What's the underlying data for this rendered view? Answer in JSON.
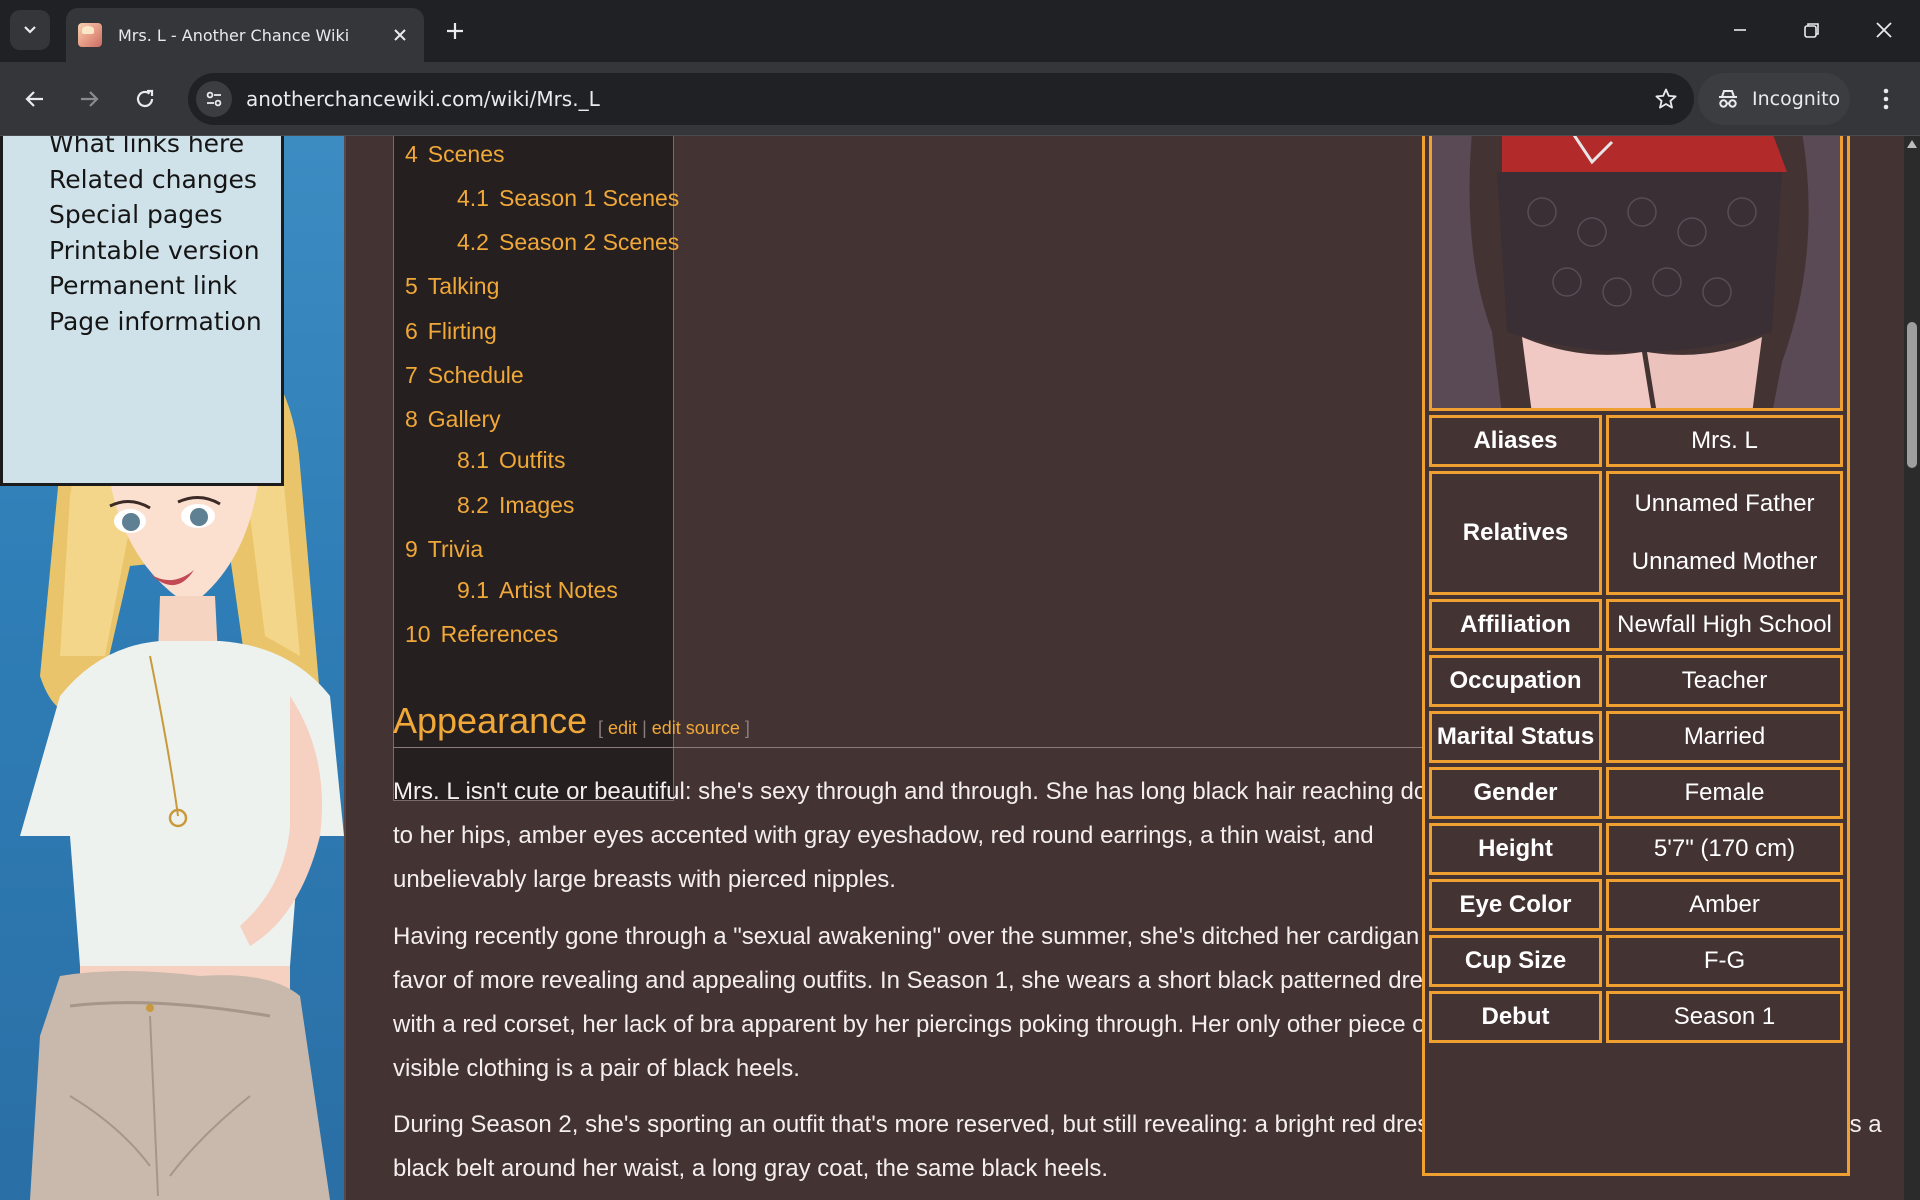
{
  "browser": {
    "tab_title": "Mrs. L - Another Chance Wiki",
    "url": "anotherchancewiki.com/wiki/Mrs._L",
    "profile_label": "Incognito"
  },
  "sidebar_tools": [
    "What links here",
    "Related changes",
    "Special pages",
    "Printable version",
    "Permanent link",
    "Page information"
  ],
  "toc": [
    {
      "num": "4",
      "label": "Scenes"
    },
    {
      "num": "4.1",
      "label": "Season 1 Scenes"
    },
    {
      "num": "4.2",
      "label": "Season 2 Scenes"
    },
    {
      "num": "5",
      "label": "Talking"
    },
    {
      "num": "6",
      "label": "Flirting"
    },
    {
      "num": "7",
      "label": "Schedule"
    },
    {
      "num": "8",
      "label": "Gallery"
    },
    {
      "num": "8.1",
      "label": "Outfits"
    },
    {
      "num": "8.2",
      "label": "Images"
    },
    {
      "num": "9",
      "label": "Trivia"
    },
    {
      "num": "9.1",
      "label": "Artist Notes"
    },
    {
      "num": "10",
      "label": "References"
    }
  ],
  "section": {
    "title": "Appearance",
    "edit_open": "[",
    "edit_label": "edit",
    "edit_sep": "|",
    "edit_source_label": "edit source",
    "edit_close": "]"
  },
  "paragraphs": [
    "Mrs. L isn't cute or beautiful: she's sexy through and through. She has long black hair reaching down to her hips, amber eyes accented with gray eyeshadow, red round earrings, a thin waist, and unbelievably large breasts with pierced nipples.",
    "Having recently gone through a \"sexual awakening\" over the summer, she's ditched her cardigan in favor of more revealing and appealing outfits. In Season 1, she wears a short black patterned dress with a red corset, her lack of bra apparent by her piercings poking through. Her only other piece of visible clothing is a pair of black heels.",
    "During Season 2, she's sporting an outfit that's more reserved, but still revealing: a bright red dress with a black bra underneath, as well as a black belt around her waist, a long gray coat, the same black heels."
  ],
  "infobox": {
    "aliases_label": "Aliases",
    "aliases_value": "Mrs. L",
    "relatives_label": "Relatives",
    "relatives_value_1": "Unnamed Father",
    "relatives_value_2": "Unnamed Mother",
    "affiliation_label": "Affiliation",
    "affiliation_value": "Newfall High School",
    "occupation_label": "Occupation",
    "occupation_value": "Teacher",
    "marital_label": "Marital Status",
    "marital_value": "Married",
    "gender_label": "Gender",
    "gender_value": "Female",
    "height_label": "Height",
    "height_value": "5'7\" (170 cm)",
    "eye_label": "Eye Color",
    "eye_value": "Amber",
    "cup_label": "Cup Size",
    "cup_value": "F-G",
    "debut_label": "Debut",
    "debut_value": "Season 1"
  },
  "colors": {
    "accent": "#f0a838",
    "content_bg": "#443333",
    "toc_bg": "#261f20",
    "infobox_border": "#f0a030"
  },
  "icons": [
    "tab-search-icon",
    "close-icon",
    "plus-icon",
    "minimize-icon",
    "restore-icon",
    "window-close-icon",
    "back-icon",
    "forward-icon",
    "reload-icon",
    "site-info-icon",
    "star-icon",
    "incognito-icon",
    "kebab-menu-icon"
  ]
}
